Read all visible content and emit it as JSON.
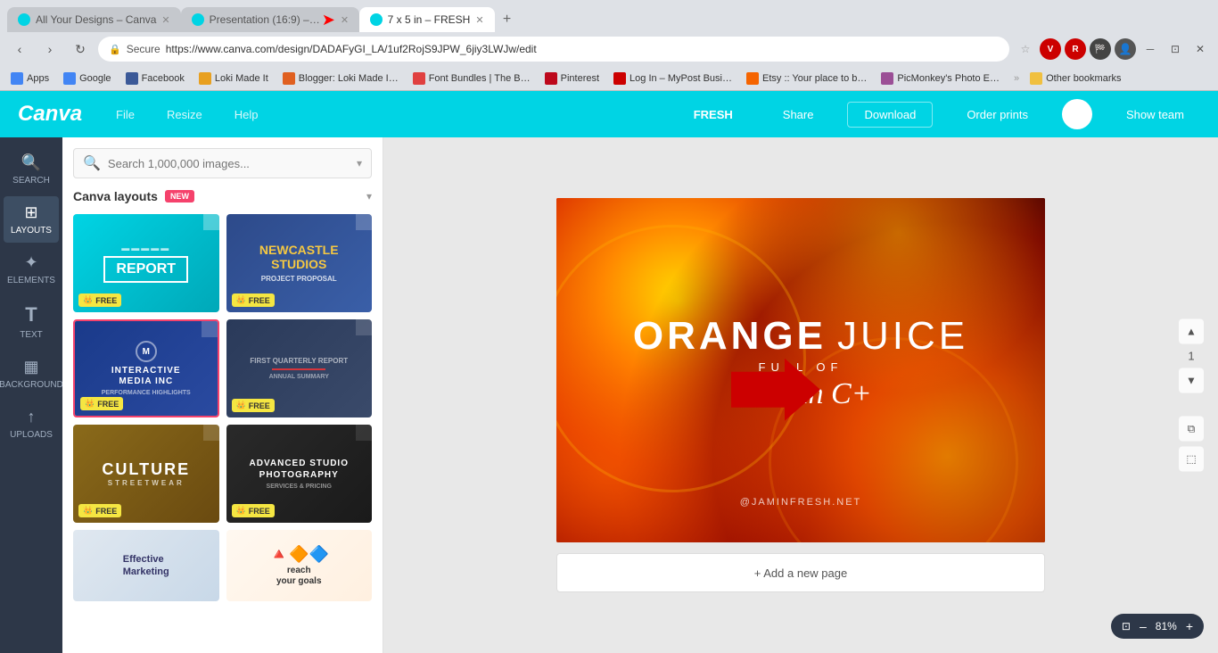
{
  "browser": {
    "tabs": [
      {
        "id": "tab1",
        "label": "All Your Designs – Canva",
        "icon_color": "#00d4e4",
        "active": false
      },
      {
        "id": "tab2",
        "label": "Presentation (16:9) –…",
        "icon_color": "#00d4e4",
        "active": false
      },
      {
        "id": "tab3",
        "label": "7 x 5 in – FRESH",
        "icon_color": "#00d4e4",
        "active": true
      }
    ],
    "address": "https://www.canva.com/design/DADAFyGI_LA/1uf2RojS9JPW_6jiy3LWJw/edit",
    "lock_label": "Secure",
    "bookmarks": [
      {
        "label": "Apps",
        "icon_color": "#4285f4"
      },
      {
        "label": "Google",
        "icon_color": "#4285f4"
      },
      {
        "label": "Facebook",
        "icon_color": "#3b5998"
      },
      {
        "label": "Loki Made It",
        "icon_color": "#e8a020"
      },
      {
        "label": "Blogger: Loki Made I…",
        "icon_color": "#e06020"
      },
      {
        "label": "Font Bundles | The B…",
        "icon_color": "#e04040"
      },
      {
        "label": "Pinterest",
        "icon_color": "#bd081c"
      },
      {
        "label": "Log In – MyPost Busi…",
        "icon_color": "#cc0000"
      },
      {
        "label": "Etsy :: Your place to b…",
        "icon_color": "#f56400"
      },
      {
        "label": "PicMonkey's Photo E…",
        "icon_color": "#9b4f96"
      },
      {
        "label": "Other bookmarks",
        "icon_color": "#f0c040"
      }
    ]
  },
  "app_header": {
    "logo": "Canva",
    "menu_items": [
      "File",
      "Resize",
      "Help"
    ],
    "title": "FRESH",
    "share_label": "Share",
    "download_label": "Download",
    "order_label": "Order prints",
    "show_team_label": "Show team"
  },
  "sidebar": {
    "items": [
      {
        "id": "search",
        "icon": "🔍",
        "label": "SEARCH"
      },
      {
        "id": "layouts",
        "icon": "⊞",
        "label": "LAYOUTS",
        "active": true
      },
      {
        "id": "elements",
        "icon": "✦",
        "label": "ELEMENTS"
      },
      {
        "id": "text",
        "icon": "T",
        "label": "TEXT"
      },
      {
        "id": "background",
        "icon": "▦",
        "label": "BACKGROUND"
      },
      {
        "id": "uploads",
        "icon": "↑",
        "label": "UPLOADS"
      }
    ]
  },
  "left_panel": {
    "search_placeholder": "Search 1,000,000 images...",
    "layouts_title": "Canva layouts",
    "new_badge": "NEW",
    "templates": [
      {
        "id": "report",
        "type": "report",
        "style": "tmpl-report",
        "title": "REPORT",
        "free": true,
        "selected": false
      },
      {
        "id": "newcastle",
        "type": "newcastle",
        "style": "tmpl-newcastle",
        "title": "NEWCASTLE STUDIOS",
        "subtitle": "PROJECT PROPOSAL",
        "free": true,
        "selected": false
      },
      {
        "id": "interactive",
        "type": "interactive",
        "style": "tmpl-interactive",
        "title": "INTERACTIVE MEDIA INC",
        "subtitle": "PERFORMANCE HIGHLIGHTS",
        "free": true,
        "selected": true
      },
      {
        "id": "quarterly",
        "type": "quarterly",
        "style": "tmpl-quarterly",
        "title": "FIRST QUARTERLY REPORT",
        "free": true,
        "selected": false
      },
      {
        "id": "culture",
        "type": "culture",
        "style": "tmpl-culture",
        "title": "CULTURE",
        "subtitle": "STREETWEAR",
        "free": true,
        "selected": false
      },
      {
        "id": "studio",
        "type": "studio",
        "style": "tmpl-studio",
        "title": "ADVANCED STUDIO PHOTOGRAPHY",
        "free": true,
        "selected": false
      }
    ],
    "bottom_templates": [
      {
        "id": "effective",
        "label": "Effective Marketing"
      },
      {
        "id": "reach",
        "label": "reach your goals"
      }
    ]
  },
  "canvas": {
    "main_title_bold": "ORANGE",
    "main_title_light": "JUICE",
    "full_of": "FULL OF",
    "vitamin": "Vitamin C+",
    "website": "@JAMINFRESH.NET",
    "add_page": "+ Add a new page",
    "page_number": "1",
    "zoom_level": "81%",
    "zoom_minus": "–",
    "zoom_plus": "+"
  },
  "icons": {
    "crown": "👑",
    "chevron_down": "▾",
    "fold": "◤",
    "arrow": "➤"
  }
}
